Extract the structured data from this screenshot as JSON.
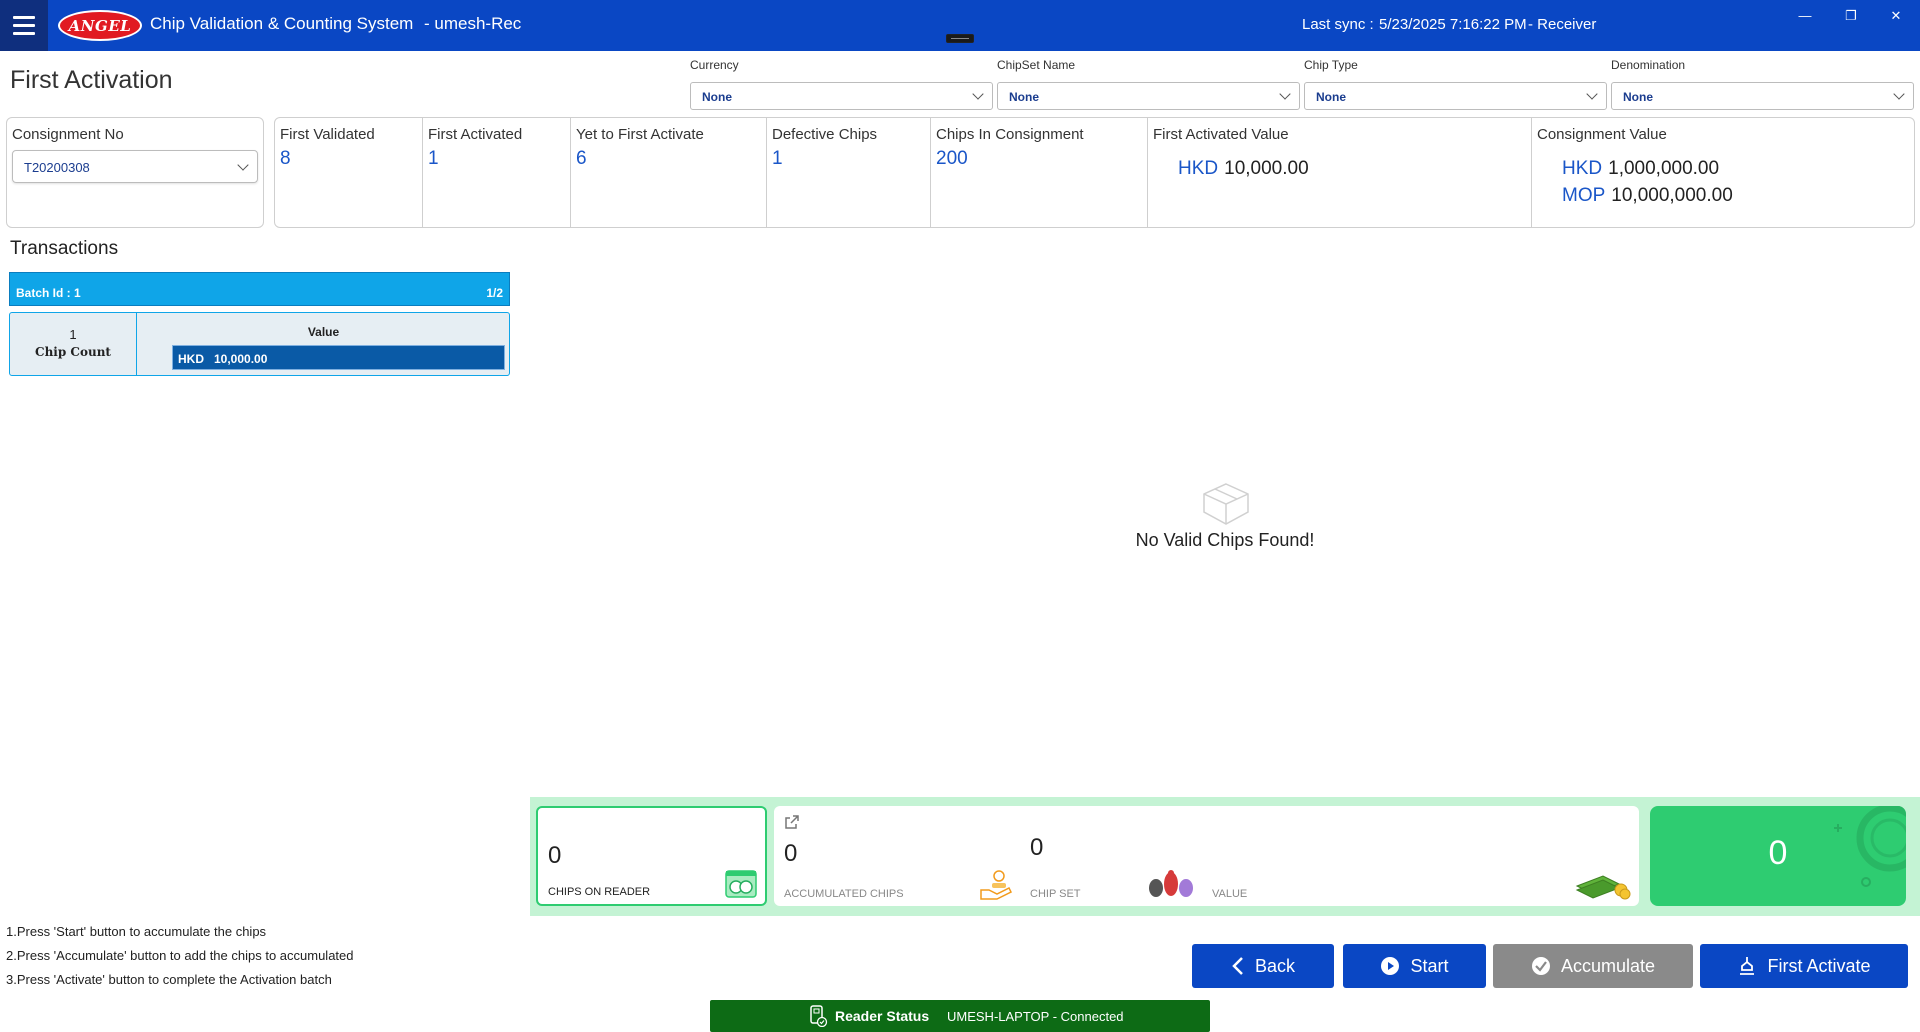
{
  "titlebar": {
    "logo_text": "ANGEL",
    "app_title": "Chip Validation & Counting System",
    "user": "- umesh-Rec",
    "sync_label": "Last sync :",
    "sync_time": "5/23/2025 7:16:22 PM",
    "role": "- Receiver",
    "minimize": "—",
    "restore": "❐",
    "close": "✕"
  },
  "page": {
    "title": "First Activation"
  },
  "filters": {
    "currency": {
      "label": "Currency",
      "value": "None"
    },
    "chipset": {
      "label": "ChipSet Name",
      "value": "None"
    },
    "chip_type": {
      "label": "Chip Type",
      "value": "None"
    },
    "denomination": {
      "label": "Denomination",
      "value": "None"
    }
  },
  "consignment": {
    "label": "Consignment No",
    "value": "T20200308"
  },
  "stats": {
    "first_validated": {
      "label": "First Validated",
      "value": "8"
    },
    "first_activated": {
      "label": "First Activated",
      "value": "1"
    },
    "yet_to_activate": {
      "label": "Yet to First Activate",
      "value": "6"
    },
    "defective": {
      "label": "Defective Chips",
      "value": "1"
    },
    "in_consignment": {
      "label": "Chips In Consignment",
      "value": "200"
    },
    "first_activated_value": {
      "label": "First Activated Value",
      "rows": [
        {
          "currency": "HKD",
          "amount": "10,000.00"
        }
      ]
    },
    "consignment_value": {
      "label": "Consignment Value",
      "rows": [
        {
          "currency": "HKD",
          "amount": "1,000,000.00"
        },
        {
          "currency": "MOP",
          "amount": "10,000,000.00"
        }
      ]
    }
  },
  "transactions": {
    "title": "Transactions",
    "batch_label": "Batch Id :  1",
    "page": "1/2",
    "chip_count_value": "1",
    "chip_count_label": "Chip Count",
    "value_header": "Value",
    "value_currency": "HKD",
    "value_amount": "10,000.00"
  },
  "empty_state": {
    "icon": "empty-box-icon",
    "text": "No Valid Chips Found!"
  },
  "counters": {
    "chips_on_reader": {
      "value": "0",
      "label": "CHIPS ON READER",
      "icon": "chip-reader-icon"
    },
    "accumulated": {
      "value": "0",
      "label": "ACCUMULATED CHIPS",
      "icon": "hand-coins-icon"
    },
    "chip_set": {
      "value": "0",
      "label": "CHIP SET",
      "icon": "chip-set-icon"
    },
    "value": {
      "value": "",
      "label": "VALUE",
      "icon": "money-stack-icon"
    },
    "total": {
      "value": "0"
    }
  },
  "instructions": [
    "1.Press 'Start' button to accumulate the chips",
    "2.Press 'Accumulate' button to add the chips to accumulated",
    "3.Press 'Activate' button to complete the Activation batch"
  ],
  "buttons": {
    "back": "Back",
    "start": "Start",
    "accumulate": "Accumulate",
    "first_activate": "First Activate"
  },
  "reader": {
    "title": "Reader Status",
    "value": "UMESH-LAPTOP - Connected"
  },
  "colors": {
    "titlebar": "#0a47c4",
    "accent_blue": "#1a56c8",
    "batch_bar": "#0fa5e8",
    "counter_bg": "#c4f3d4",
    "total_green": "#2ecc71",
    "reader_green": "#0d6b15",
    "disabled_grey": "#8a8a8a"
  }
}
